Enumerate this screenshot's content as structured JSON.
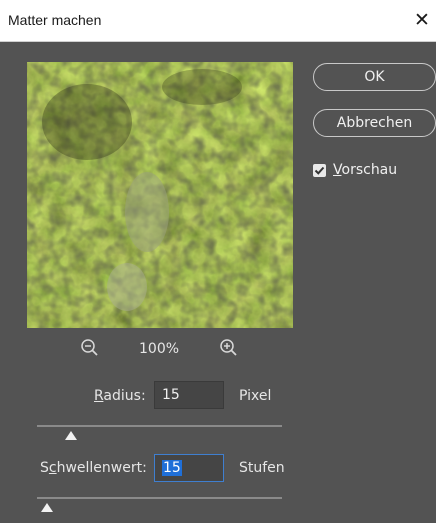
{
  "window": {
    "title": "Matter machen",
    "close_glyph": "✕"
  },
  "buttons": {
    "ok": "OK",
    "cancel": "Abbrechen"
  },
  "preview_option": {
    "label": "Vorschau",
    "checked": true
  },
  "zoom": {
    "value": "100%"
  },
  "radius": {
    "label": "Radius:",
    "value": "15",
    "unit": "Pixel",
    "slider_fraction": 0.14
  },
  "threshold": {
    "label": "Schwellenwert:",
    "value": "15",
    "unit": "Stufen",
    "slider_fraction": 0.04
  },
  "icons": [
    "zoom-out-icon",
    "zoom-in-icon",
    "checkmark-icon",
    "close-icon"
  ],
  "colors": {
    "background": "#535353",
    "accent": "#1f6fd8",
    "titlebar": "#ffffff"
  }
}
